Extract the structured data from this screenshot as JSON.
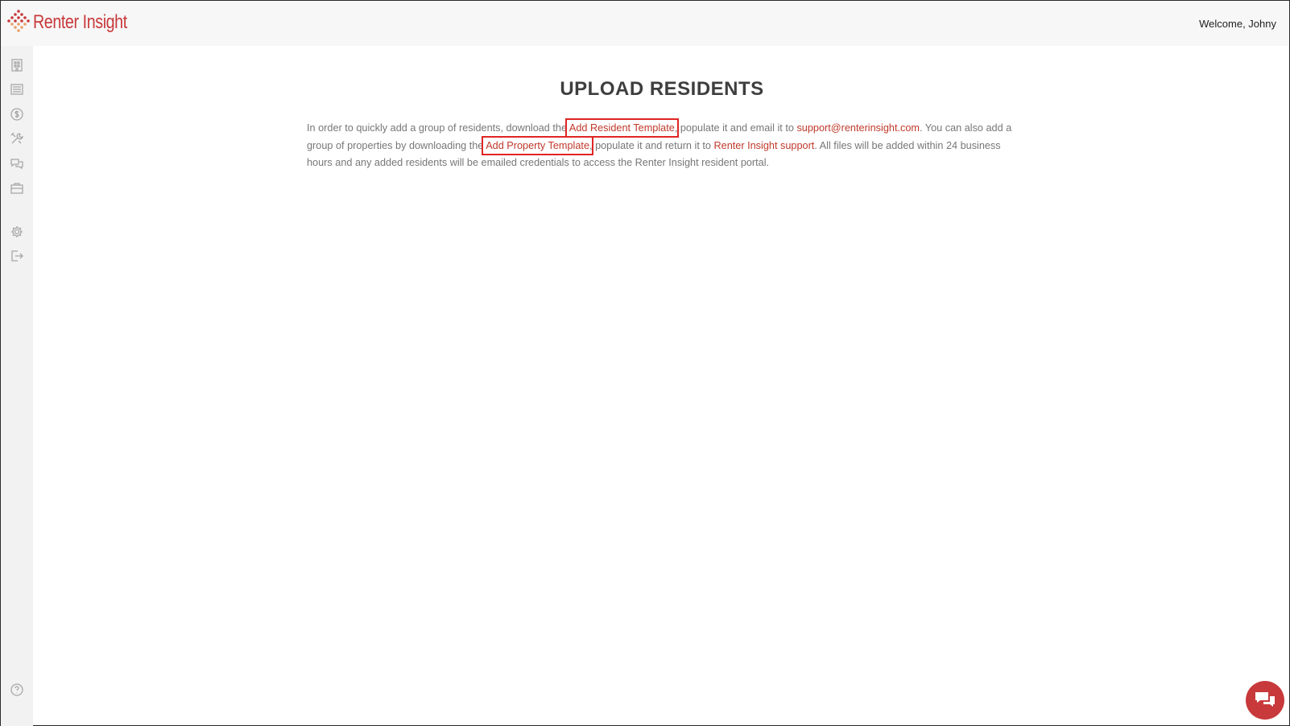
{
  "header": {
    "brand": "Renter Insight",
    "welcome": "Welcome, Johny"
  },
  "sidebar": {
    "items": [
      {
        "icon": "building-icon"
      },
      {
        "icon": "list-icon"
      },
      {
        "icon": "dollar-icon"
      },
      {
        "icon": "tools-icon"
      },
      {
        "icon": "chat-icon"
      },
      {
        "icon": "briefcase-icon"
      },
      {
        "icon": "gear-icon"
      },
      {
        "icon": "logout-icon"
      },
      {
        "icon": "help-icon"
      }
    ]
  },
  "main": {
    "title": "UPLOAD RESIDENTS",
    "text_1": "In order to quickly add a group of residents, download the ",
    "link_resident_template": "Add Resident Template",
    "text_2": ", populate it and email it to ",
    "link_support_email": "support@renterinsight.com",
    "text_3": ". You can also add a group of properties by downloading the ",
    "link_property_template": "Add Property Template",
    "text_4": ", populate it and return it to ",
    "link_support": "Renter Insight support",
    "text_5": ". All files will be added within 24 business hours and any added residents will be emailed credentials to access the Renter Insight resident portal."
  },
  "colors": {
    "accent": "#c8393b",
    "link": "#c0392b",
    "highlight": "#e02424"
  }
}
